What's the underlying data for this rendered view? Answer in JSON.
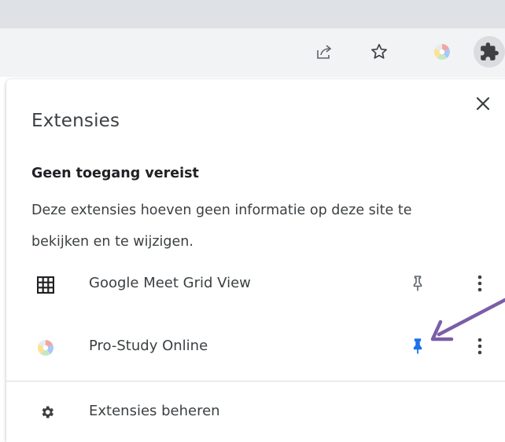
{
  "toolbar": {
    "share_icon": "share-icon",
    "star_icon": "star-icon",
    "profile_extension_icon": "pro-study-online-icon",
    "extensions_icon": "puzzle-icon"
  },
  "panel": {
    "title": "Extensies",
    "close_icon": "close-icon",
    "section": {
      "heading": "Geen toegang vereist",
      "description": "Deze extensies hoeven geen informatie op deze site te bekijken en te wijzigen."
    },
    "extensions": [
      {
        "name": "Google Meet Grid View",
        "icon": "grid-icon",
        "pinned": false
      },
      {
        "name": "Pro-Study Online",
        "icon": "pro-study-online-icon",
        "pinned": true
      }
    ],
    "manage_label": "Extensies beheren",
    "manage_icon": "gear-icon"
  },
  "colors": {
    "pinned": "#1a73e8",
    "unpinned": "#5f6368",
    "annotation_arrow": "#7b5ea7",
    "toolbar_bg": "#f1f3f4",
    "tab_strip_bg": "#dee1e6"
  }
}
